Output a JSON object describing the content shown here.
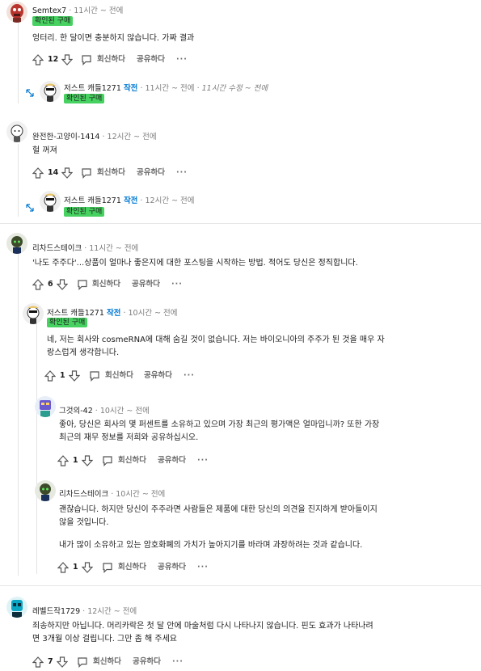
{
  "labels": {
    "reply": "회신하다",
    "share": "공유하다",
    "more": "···",
    "badge": "확인된 구매",
    "op": "작전"
  },
  "comments": [
    {
      "user": "Semtex7",
      "time": "11시간 ~ 전에",
      "badge": "확인된 구매",
      "body": "엉터리. 한 달이면 충분하지 않습니다. 가짜 결과",
      "votes": "12"
    },
    {
      "user": "저스트 캐들1271",
      "op": "작전",
      "time": "11시간 ~ 전에",
      "edited": "11시간 수정 ~ 전에",
      "badge": "확인된 구매"
    },
    {
      "user": "완전한-고양이-1414",
      "time": "12시간 ~ 전에",
      "body": "헐 꺼져",
      "votes": "14"
    },
    {
      "user": "저스트 캐들1271",
      "op": "작전",
      "time": "12시간 ~ 전에",
      "badge": "확인된 구매"
    },
    {
      "user": "리차드스테이크",
      "time": "11시간 ~ 전에",
      "body": "'나도 주주다'...상품이 얼마나 좋은지에 대한 포스팅을 시작하는 방법. 적어도 당신은 정직합니다.",
      "votes": "6"
    },
    {
      "user": "저스트 캐들1271",
      "op": "작전",
      "time": "10시간 ~ 전에",
      "badge": "확인된 구매",
      "body1": "네, 저는 회사와 cosmeRNA에 대해 숨길 것이 없습니다. 저는 바이오니아의 주주가 된 것을 매우 자",
      "body2": "랑스럽게 생각합니다.",
      "votes": "1"
    },
    {
      "user": "그것의-42",
      "time": "10시간 ~ 전에",
      "body1": "좋아, 당신은 회사의 몇 퍼센트를 소유하고 있으며 가장 최근의 평가액은 얼마입니까? 또한 가장",
      "body2": "최근의 재무 정보를 저희와 공유하십시오.",
      "votes": "1"
    },
    {
      "user": "리차드스테이크",
      "time": "10시간 ~ 전에",
      "body1": "괜찮습니다. 하지만 당신이 주주라면 사람들은 제품에 대한 당신의 의견을 진지하게 받아들이지",
      "body2": "않을 것입니다.",
      "body3": "내가 많이 소유하고 있는 암호화폐의 가치가 높아지기를 바라며 과장하려는 것과 같습니다.",
      "votes": "1"
    },
    {
      "user": "레벨드작1729",
      "time": "12시간 ~ 전에",
      "body1": "죄송하지만 아닙니다. 머리카락은 첫 달 안에 마술처럼 다시 나타나지 않습니다. 핀도 효과가 나타나려",
      "body2": "면 3개월 이상 걸립니다. 그만 좀 해 주세요",
      "votes": "7"
    }
  ]
}
